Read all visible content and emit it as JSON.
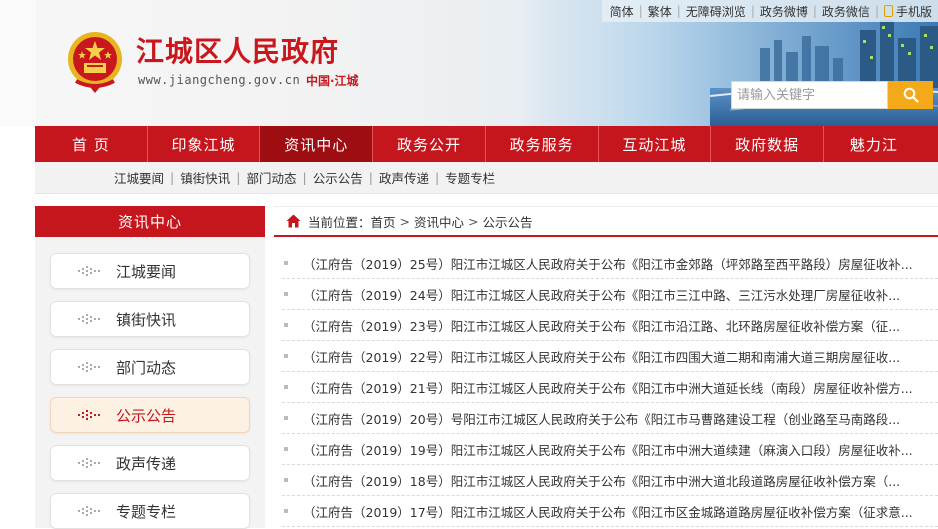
{
  "header": {
    "title": "江城区人民政府",
    "url": "www.jiangcheng.gov.cn",
    "region": "中国·江城",
    "top_links": [
      "简体",
      "繁体",
      "无障碍浏览",
      "政务微博",
      "政务微信",
      "手机版"
    ],
    "search": {
      "placeholder": "请输入关键字"
    }
  },
  "nav": {
    "items": [
      "首 页",
      "印象江城",
      "资讯中心",
      "政务公开",
      "政务服务",
      "互动江城",
      "政府数据",
      "魅力江"
    ],
    "active": "资讯中心"
  },
  "subnav": {
    "items": [
      "江城要闻",
      "镇街快讯",
      "部门动态",
      "公示公告",
      "政声传递",
      "专题专栏"
    ]
  },
  "sidebar": {
    "title": "资讯中心",
    "items": [
      "江城要闻",
      "镇街快讯",
      "部门动态",
      "公示公告",
      "政声传递",
      "专题专栏"
    ],
    "active": "公示公告"
  },
  "breadcrumb": {
    "label": "当前位置：",
    "items": [
      "首页",
      "资讯中心",
      "公示公告"
    ]
  },
  "articles": [
    "（江府告（2019）25号）阳江市江城区人民政府关于公布《阳江市金郊路（坪郊路至西平路段）房屋征收补...",
    "（江府告（2019）24号）阳江市江城区人民政府关于公布《阳江市三江中路、三江污水处理厂房屋征收补...",
    "（江府告（2019）23号）阳江市江城区人民政府关于公布《阳江市沿江路、北环路房屋征收补偿方案（征...",
    "（江府告（2019）22号）阳江市江城区人民政府关于公布《阳江市四围大道二期和南浦大道三期房屋征收...",
    "（江府告（2019）21号）阳江市江城区人民政府关于公布《阳江市中洲大道延长线（南段）房屋征收补偿方...",
    "（江府告（2019）20号）号阳江市江城区人民政府关于公布《阳江市马曹路建设工程（创业路至马南路段...",
    "（江府告（2019）19号）阳江市江城区人民政府关于公布《阳江市中洲大道续建（麻演入口段）房屋征收补...",
    "（江府告（2019）18号）阳江市江城区人民政府关于公布《阳江市中洲大道北段道路房屋征收补偿方案（...",
    "（江府告（2019）17号）阳江市江城区人民政府关于公布《阳江市区金城路道路房屋征收补偿方案（征求意..."
  ],
  "colors": {
    "brand_red": "#c4161c",
    "nav_active": "#9e0d12",
    "search_btn": "#f4a91a",
    "sidebar_active_bg": "#fdf1e4"
  },
  "icons": {
    "emblem": "national-emblem-icon",
    "search": "search-icon",
    "home": "home-icon",
    "phone": "phone-icon",
    "bullet": "dots-icon"
  }
}
